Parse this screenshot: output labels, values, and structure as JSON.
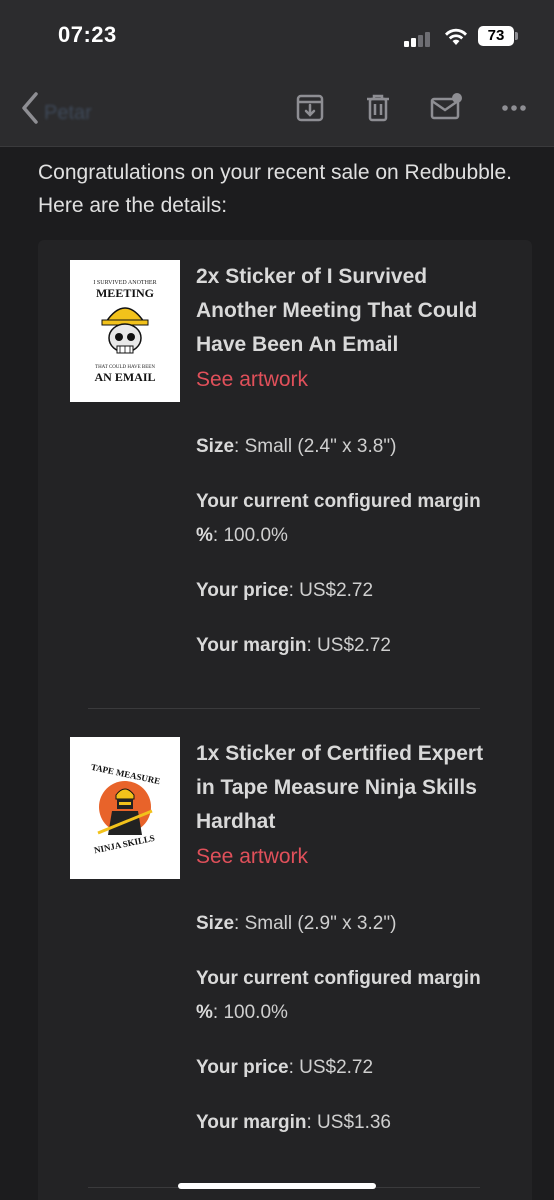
{
  "status_bar": {
    "time": "07:23",
    "battery": "73"
  },
  "header": {
    "sender": "Petar"
  },
  "email": {
    "intro": "Congratulations on your recent sale on Redbubble. Here are the details:",
    "items": [
      {
        "title": "2x Sticker of I Survived Another Meeting That Could Have Been An Email",
        "link": "See artwork",
        "artwork_text": {
          "top": "I SURVIVED ANOTHER",
          "main": "MEETING",
          "sub": "THAT COULD HAVE BEEN",
          "bottom": "AN EMAIL"
        },
        "size_label": "Size",
        "size_value": ": Small (2.4\" x 3.8\")",
        "margin_pct_label": "Your current configured margin %",
        "margin_pct_value": ": 100.0%",
        "price_label": "Your price",
        "price_value": ": US$2.72",
        "margin_label": "Your margin",
        "margin_value": ": US$2.72"
      },
      {
        "title": "1x Sticker of Certified Expert in Tape Measure Ninja Skills Hardhat",
        "link": "See artwork",
        "artwork_text": {
          "top": "TAPE MEASURE",
          "bottom": "NINJA SKILLS"
        },
        "size_label": "Size",
        "size_value": ": Small (2.9\" x 3.2\")",
        "margin_pct_label": "Your current configured margin %",
        "margin_pct_value": ": 100.0%",
        "price_label": "Your price",
        "price_value": ": US$2.72",
        "margin_label": "Your margin",
        "margin_value": ": US$1.36"
      }
    ]
  },
  "colors": {
    "link": "#e0505a",
    "background": "#1c1c1e",
    "header": "#2c2c2e"
  }
}
